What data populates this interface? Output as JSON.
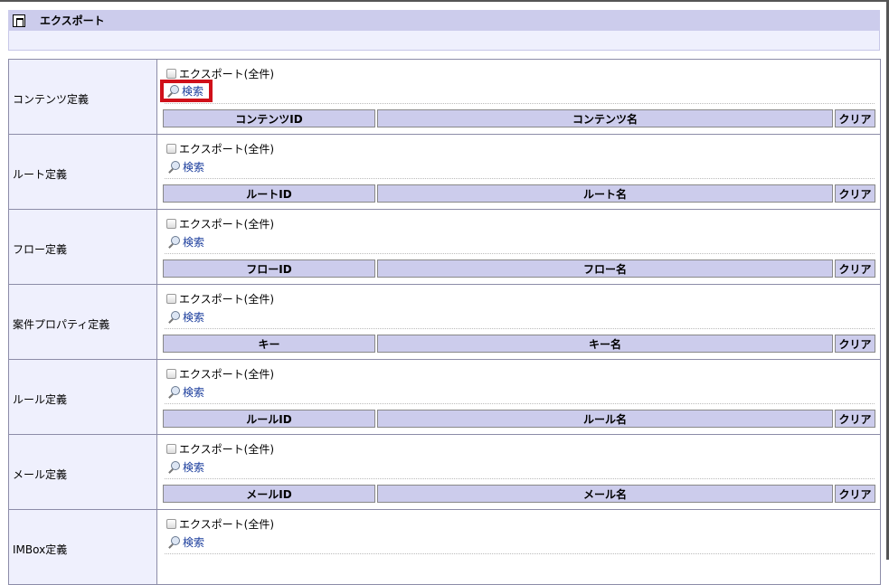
{
  "title": "エクスポート",
  "export_all_label": "エクスポート(全件)",
  "search_label": "検索",
  "clear_label": "クリア",
  "rows": [
    {
      "label": "コンテンツ定義",
      "col_id": "コンテンツID",
      "col_name": "コンテンツ名"
    },
    {
      "label": "ルート定義",
      "col_id": "ルートID",
      "col_name": "ルート名"
    },
    {
      "label": "フロー定義",
      "col_id": "フローID",
      "col_name": "フロー名"
    },
    {
      "label": "案件プロパティ定義",
      "col_id": "キー",
      "col_name": "キー名"
    },
    {
      "label": "ルール定義",
      "col_id": "ルールID",
      "col_name": "ルール名"
    },
    {
      "label": "メール定義",
      "col_id": "メールID",
      "col_name": "メール名"
    },
    {
      "label": "IMBox定義"
    }
  ],
  "highlight_color": "#d0101a"
}
